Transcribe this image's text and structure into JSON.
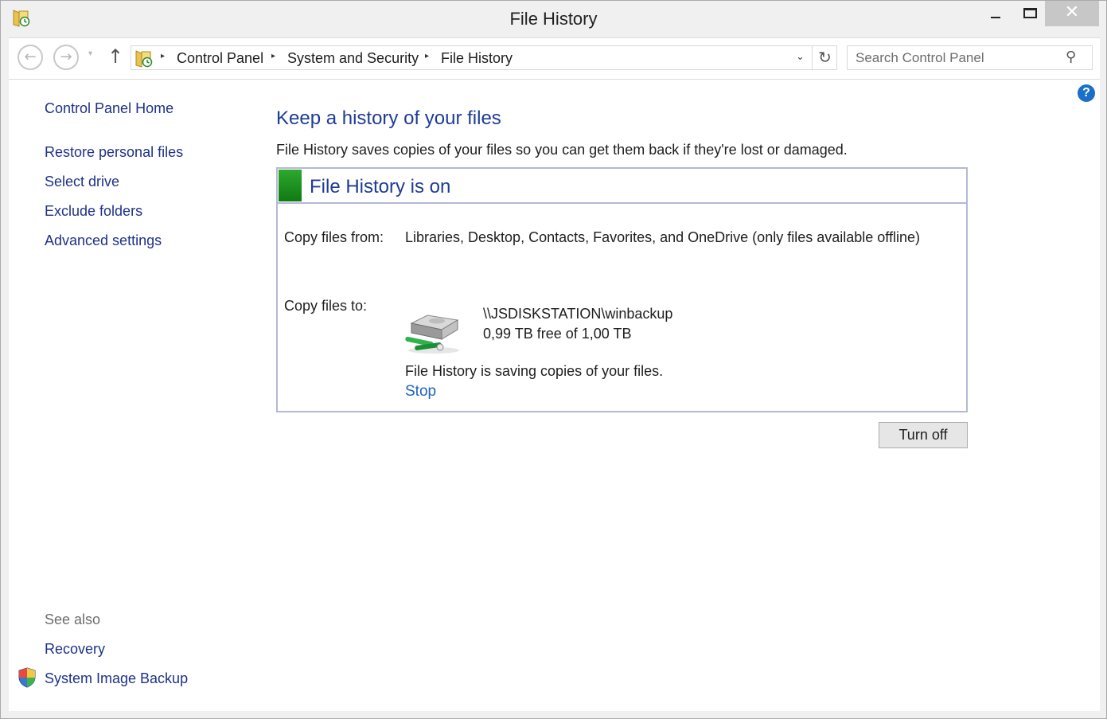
{
  "window": {
    "title": "File History",
    "close_glyph": "✕"
  },
  "nav": {
    "back_glyph": "←",
    "forward_glyph": "→",
    "recent_glyph": "▾",
    "up_glyph": "↑",
    "breadcrumb": [
      "Control Panel",
      "System and Security",
      "File History"
    ],
    "separator_glyph": "▸",
    "dropdown_glyph": "⌄",
    "refresh_glyph": "↻",
    "search_placeholder": "Search Control Panel",
    "search_glyph": "⚲"
  },
  "sidebar": {
    "home": "Control Panel Home",
    "items": [
      "Restore personal files",
      "Select drive",
      "Exclude folders",
      "Advanced settings"
    ],
    "see_also_title": "See also",
    "see_also": [
      "Recovery",
      "System Image Backup"
    ]
  },
  "help": {
    "glyph": "?"
  },
  "main": {
    "title": "Keep a history of your files",
    "description": "File History saves copies of your files so you can get them back if they're lost or damaged.",
    "status_title": "File History is on",
    "status_color": "#1f8f22",
    "copy_from_label": "Copy files from:",
    "copy_from_value": "Libraries, Desktop, Contacts, Favorites, and OneDrive (only files available offline)",
    "copy_to_label": "Copy files to:",
    "drive_path": "\\\\JSDISKSTATION\\winbackup",
    "drive_free": "0,99 TB free of 1,00 TB",
    "saving_status": "File History is saving copies of your files.",
    "stop_link": "Stop",
    "turn_off_button": "Turn off"
  }
}
